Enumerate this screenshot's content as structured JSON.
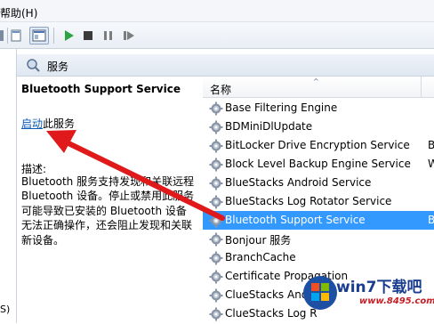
{
  "menubar": {
    "help": "帮助(H)"
  },
  "toolbar": {
    "buttons": [
      "back-icon",
      "console-tree-icon",
      "start-icon",
      "stop-icon",
      "pause-icon",
      "restart-icon"
    ]
  },
  "leftpane": {
    "fragment": "S)"
  },
  "header": {
    "title": "服务"
  },
  "description": {
    "service_name": "Bluetooth Support Service",
    "start_link": "启动",
    "start_suffix": "此服务",
    "label": "描述:",
    "text": "Bluetooth 服务支持发现和关联远程 Bluetooth 设备。停止或禁用此服务可能导致已安装的 Bluetooth 设备无法正确操作，还会阻止发现和关联新设备。"
  },
  "list": {
    "column_name": "名称",
    "sort_indicator": "^",
    "rows": [
      {
        "name": "Base Filtering Engine",
        "extra": "",
        "selected": false
      },
      {
        "name": "BDMiniDlUpdate",
        "extra": "",
        "selected": false
      },
      {
        "name": "BitLocker Drive Encryption Service",
        "extra": "B",
        "selected": false
      },
      {
        "name": "Block Level Backup Engine Service",
        "extra": "W",
        "selected": false
      },
      {
        "name": "BlueStacks Android Service",
        "extra": "",
        "selected": false
      },
      {
        "name": "BlueStacks Log Rotator Service",
        "extra": "",
        "selected": false
      },
      {
        "name": "Bluetooth Support Service",
        "extra": "B",
        "selected": true
      },
      {
        "name": "Bonjour 服务",
        "extra": "",
        "selected": false
      },
      {
        "name": "BranchCache",
        "extra": "",
        "selected": false
      },
      {
        "name": "Certificate Propagation",
        "extra": "",
        "selected": false
      },
      {
        "name": "ClueStacks Andro",
        "extra": "",
        "selected": false
      },
      {
        "name": "ClueStacks Log R",
        "extra": "",
        "selected": false
      }
    ]
  },
  "watermark": {
    "text": "win7下载吧",
    "url": "www.8495.com"
  },
  "colors": {
    "selection": "#3399ff",
    "link": "#0a5bb5",
    "arrow": "#e0191b"
  }
}
